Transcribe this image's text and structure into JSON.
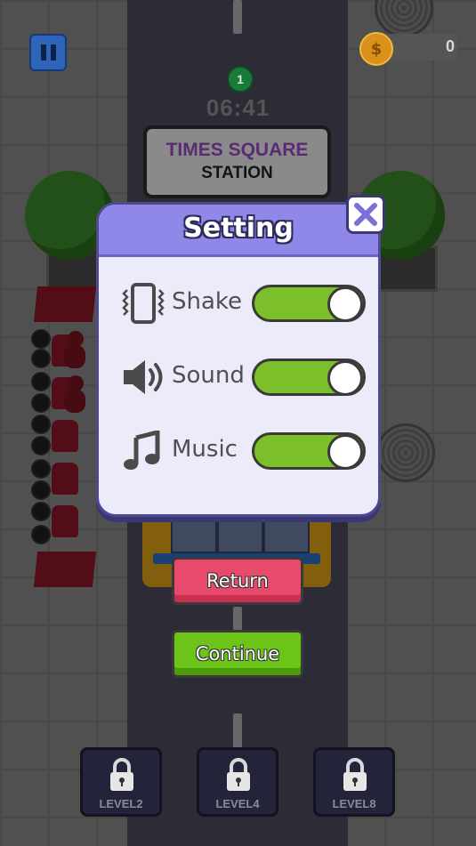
{
  "hud": {
    "coins": "0",
    "stop_number": "1",
    "timer": "06:41",
    "station_line1": "TIMES SQUARE",
    "station_line2": "STATION"
  },
  "settings": {
    "title": "Setting",
    "rows": [
      {
        "label": "Shake",
        "icon": "vibrate-phone-icon",
        "enabled": true
      },
      {
        "label": "Sound",
        "icon": "speaker-icon",
        "enabled": true
      },
      {
        "label": "Music",
        "icon": "music-note-icon",
        "enabled": true
      }
    ]
  },
  "buttons": {
    "return_label": "Return",
    "continue_label": "Continue"
  },
  "levels": [
    {
      "label": "LEVEL2",
      "locked": true
    },
    {
      "label": "LEVEL4",
      "locked": true
    },
    {
      "label": "LEVEL8",
      "locked": true
    }
  ],
  "colors": {
    "toggle_on": "#7bbf2a",
    "dialog_header": "#8f88e8",
    "return_button": "#e84a6b",
    "continue_button": "#6cc419"
  }
}
